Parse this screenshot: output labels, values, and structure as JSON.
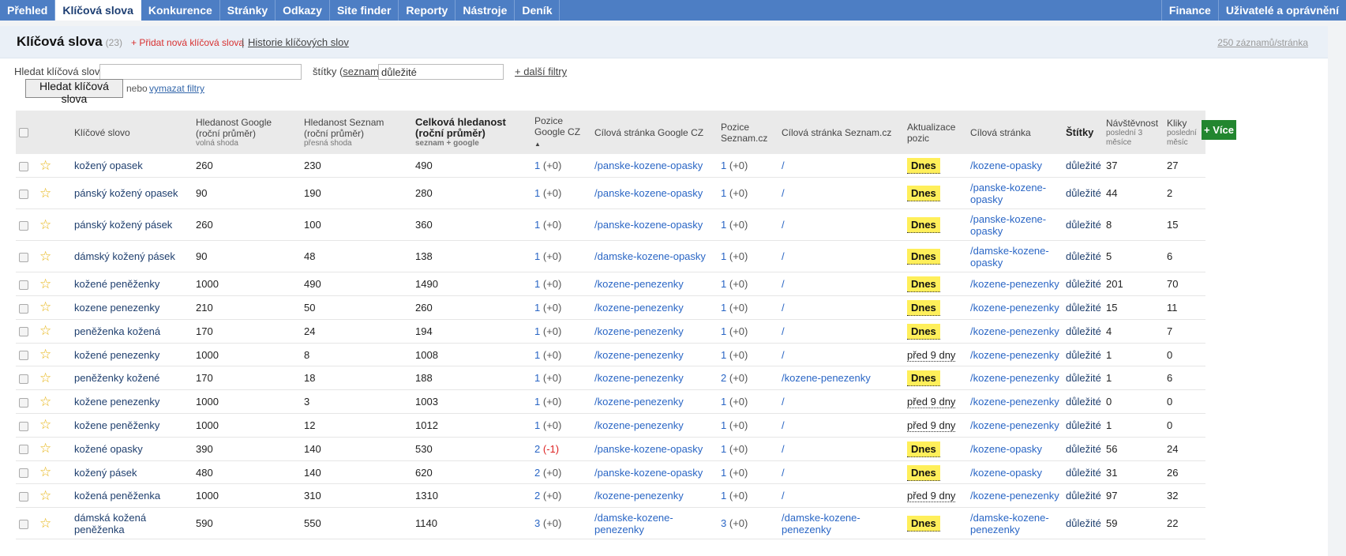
{
  "nav": {
    "left": [
      "Přehled",
      "Klíčová slova",
      "Konkurence",
      "Stránky",
      "Odkazy",
      "Site finder",
      "Reporty",
      "Nástroje",
      "Deník"
    ],
    "active_index": 1,
    "right": [
      "Finance",
      "Uživatelé a oprávnění"
    ]
  },
  "header": {
    "title": "Klíčová slova",
    "count": "(23)",
    "add_link": "+ Přidat nová klíčová slova",
    "separator": "|",
    "history_link": "Historie klíčových slov",
    "per_page": "250 záznamů/stránka"
  },
  "filters": {
    "search_label": "Hledat klíčová slova",
    "search_value": "",
    "tags_label_prefix": "štítky (",
    "tags_label_link": "seznam",
    "tags_label_suffix": ")",
    "tags_value": "důležité",
    "more_filters": "+ další filtry",
    "search_button": "Hledat klíčová slova",
    "or_text": "nebo",
    "clear_filters": "vymazat filtry"
  },
  "more_button": "+ Více",
  "columns": {
    "keyword": "Klíčové slovo",
    "google_vol": "Hledanost Google (roční průměr)",
    "google_vol_sub": "volná shoda",
    "seznam_vol": "Hledanost Seznam (roční průměr)",
    "seznam_vol_sub": "přesná shoda",
    "total_vol": "Celková hledanost (roční průměr)",
    "total_vol_sub": "seznam + google",
    "pos_google": "Pozice Google CZ",
    "sort_icon": "▲",
    "target_google": "Cílová stránka Google CZ",
    "pos_seznam": "Pozice Seznam.cz",
    "target_seznam": "Cílová stránka Seznam.cz",
    "update": "Aktualizace pozic",
    "target": "Cílová stránka",
    "tags": "Štítky",
    "visits": "Návštěvnost",
    "visits_sub": "poslední 3 měsíce",
    "clicks": "Kliky",
    "clicks_sub": "poslední měsíc"
  },
  "colors": {
    "nav_bg": "#4d7ec4",
    "link": "#2a66c5",
    "badge": "#ffef5a",
    "star": "#e6b310",
    "more_button": "#22862f"
  },
  "rows": [
    {
      "kw": "kožený opasek",
      "g": "260",
      "s": "230",
      "t": "490",
      "pg": "1",
      "pgc": "(+0)",
      "tg": "/panske-kozene-opasky",
      "ps": "1",
      "psc": "(+0)",
      "ts": "/",
      "upd": "Dnes",
      "tgt": "/kozene-opasky",
      "tag": "důležité",
      "v": "37",
      "k": "27"
    },
    {
      "kw": "pánský kožený opasek",
      "g": "90",
      "s": "190",
      "t": "280",
      "pg": "1",
      "pgc": "(+0)",
      "tg": "/panske-kozene-opasky",
      "ps": "1",
      "psc": "(+0)",
      "ts": "/",
      "upd": "Dnes",
      "tgt": "/panske-kozene-opasky",
      "tag": "důležité",
      "v": "44",
      "k": "2"
    },
    {
      "kw": "pánský kožený pásek",
      "g": "260",
      "s": "100",
      "t": "360",
      "pg": "1",
      "pgc": "(+0)",
      "tg": "/panske-kozene-opasky",
      "ps": "1",
      "psc": "(+0)",
      "ts": "/",
      "upd": "Dnes",
      "tgt": "/panske-kozene-opasky",
      "tag": "důležité",
      "v": "8",
      "k": "15"
    },
    {
      "kw": "dámský kožený pásek",
      "g": "90",
      "s": "48",
      "t": "138",
      "pg": "1",
      "pgc": "(+0)",
      "tg": "/damske-kozene-opasky",
      "ps": "1",
      "psc": "(+0)",
      "ts": "/",
      "upd": "Dnes",
      "tgt": "/damske-kozene-opasky",
      "tag": "důležité",
      "v": "5",
      "k": "6"
    },
    {
      "kw": "kožené peněženky",
      "g": "1000",
      "s": "490",
      "t": "1490",
      "pg": "1",
      "pgc": "(+0)",
      "tg": "/kozene-penezenky",
      "ps": "1",
      "psc": "(+0)",
      "ts": "/",
      "upd": "Dnes",
      "tgt": "/kozene-penezenky",
      "tag": "důležité",
      "v": "201",
      "k": "70"
    },
    {
      "kw": "kozene penezenky",
      "g": "210",
      "s": "50",
      "t": "260",
      "pg": "1",
      "pgc": "(+0)",
      "tg": "/kozene-penezenky",
      "ps": "1",
      "psc": "(+0)",
      "ts": "/",
      "upd": "Dnes",
      "tgt": "/kozene-penezenky",
      "tag": "důležité",
      "v": "15",
      "k": "11"
    },
    {
      "kw": "peněženka kožená",
      "g": "170",
      "s": "24",
      "t": "194",
      "pg": "1",
      "pgc": "(+0)",
      "tg": "/kozene-penezenky",
      "ps": "1",
      "psc": "(+0)",
      "ts": "/",
      "upd": "Dnes",
      "tgt": "/kozene-penezenky",
      "tag": "důležité",
      "v": "4",
      "k": "7"
    },
    {
      "kw": "kožené penezenky",
      "g": "1000",
      "s": "8",
      "t": "1008",
      "pg": "1",
      "pgc": "(+0)",
      "tg": "/kozene-penezenky",
      "ps": "1",
      "psc": "(+0)",
      "ts": "/",
      "upd": "před 9 dny",
      "tgt": "/kozene-penezenky",
      "tag": "důležité",
      "v": "1",
      "k": "0"
    },
    {
      "kw": "peněženky kožené",
      "g": "170",
      "s": "18",
      "t": "188",
      "pg": "1",
      "pgc": "(+0)",
      "tg": "/kozene-penezenky",
      "ps": "2",
      "psc": "(+0)",
      "ts": "/kozene-penezenky",
      "upd": "Dnes",
      "tgt": "/kozene-penezenky",
      "tag": "důležité",
      "v": "1",
      "k": "6"
    },
    {
      "kw": "kožene penezenky",
      "g": "1000",
      "s": "3",
      "t": "1003",
      "pg": "1",
      "pgc": "(+0)",
      "tg": "/kozene-penezenky",
      "ps": "1",
      "psc": "(+0)",
      "ts": "/",
      "upd": "před 9 dny",
      "tgt": "/kozene-penezenky",
      "tag": "důležité",
      "v": "0",
      "k": "0"
    },
    {
      "kw": "kožene peněženky",
      "g": "1000",
      "s": "12",
      "t": "1012",
      "pg": "1",
      "pgc": "(+0)",
      "tg": "/kozene-penezenky",
      "ps": "1",
      "psc": "(+0)",
      "ts": "/",
      "upd": "před 9 dny",
      "tgt": "/kozene-penezenky",
      "tag": "důležité",
      "v": "1",
      "k": "0"
    },
    {
      "kw": "kožené opasky",
      "g": "390",
      "s": "140",
      "t": "530",
      "pg": "2",
      "pgc": "(-1)",
      "neg": true,
      "tg": "/panske-kozene-opasky",
      "ps": "1",
      "psc": "(+0)",
      "ts": "/",
      "upd": "Dnes",
      "tgt": "/kozene-opasky",
      "tag": "důležité",
      "v": "56",
      "k": "24"
    },
    {
      "kw": "kožený pásek",
      "g": "480",
      "s": "140",
      "t": "620",
      "pg": "2",
      "pgc": "(+0)",
      "tg": "/panske-kozene-opasky",
      "ps": "1",
      "psc": "(+0)",
      "ts": "/",
      "upd": "Dnes",
      "tgt": "/kozene-opasky",
      "tag": "důležité",
      "v": "31",
      "k": "26"
    },
    {
      "kw": "kožená peněženka",
      "g": "1000",
      "s": "310",
      "t": "1310",
      "pg": "2",
      "pgc": "(+0)",
      "tg": "/kozene-penezenky",
      "ps": "1",
      "psc": "(+0)",
      "ts": "/",
      "upd": "před 9 dny",
      "tgt": "/kozene-penezenky",
      "tag": "důležité",
      "v": "97",
      "k": "32"
    },
    {
      "kw": "dámská kožená peněženka",
      "g": "590",
      "s": "550",
      "t": "1140",
      "pg": "3",
      "pgc": "(+0)",
      "tg": "/damske-kozene-penezenky",
      "ps": "3",
      "psc": "(+0)",
      "ts": "/damske-kozene-penezenky",
      "upd": "Dnes",
      "tgt": "/damske-kozene-penezenky",
      "tag": "důležité",
      "v": "59",
      "k": "22"
    }
  ]
}
